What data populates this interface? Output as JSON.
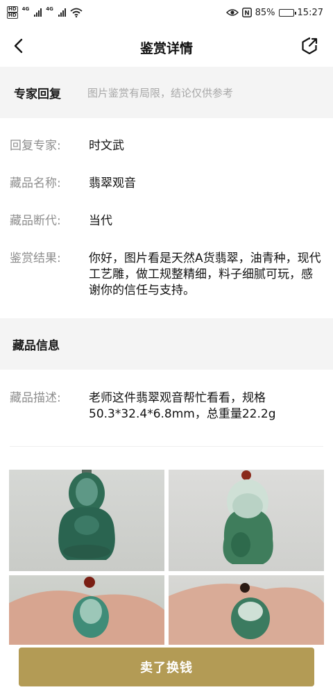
{
  "status_bar": {
    "hd1": "HD",
    "hd2": "HD",
    "net1": "4G",
    "net2": "4G",
    "battery_percent": "85%",
    "battery_level": 0.85,
    "time": "15:27",
    "nfc": "N"
  },
  "nav": {
    "title": "鉴赏详情",
    "back_icon": "chevron-left-icon",
    "share_icon": "share-icon"
  },
  "expert_section": {
    "title": "专家回复",
    "note": "图片鉴赏有局限，结论仅供参考"
  },
  "expert_rows": [
    {
      "label": "回复专家:",
      "value": "时文武"
    },
    {
      "label": "藏品名称:",
      "value": "翡翠观音"
    },
    {
      "label": "藏品断代:",
      "value": "当代"
    },
    {
      "label": "鉴赏结果:",
      "value": "你好，图片看是天然A货翡翠，油青种，现代工艺雕，做工规整精细，料子细腻可玩，感谢你的信任与支持。"
    }
  ],
  "item_section": {
    "title": "藏品信息"
  },
  "item_rows": [
    {
      "label": "藏品描述:",
      "value": "老师这件翡翠观音帮忙看看，规格50.3*32.4*6.8mm，总重量22.2g"
    }
  ],
  "action": {
    "sell_label": "卖了换钱"
  },
  "colors": {
    "accent": "#b39b55",
    "section_bg": "#f4f4f4",
    "label": "#8e8e8e",
    "jade": "#2f6c55"
  }
}
